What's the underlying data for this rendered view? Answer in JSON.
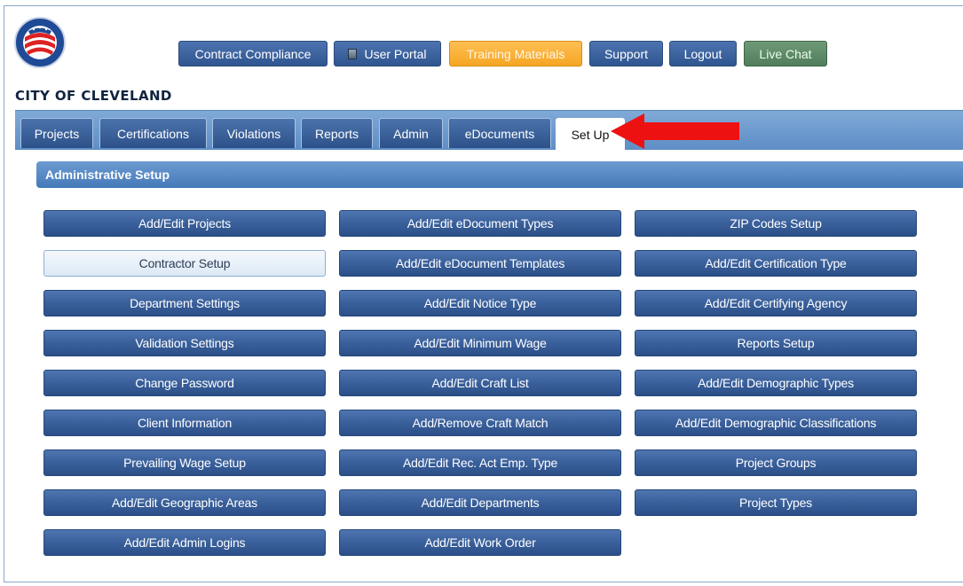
{
  "site": {
    "name": "CITY OF CLEVELAND",
    "logo_text": "CITY OF CLEVELAND OHIO"
  },
  "topnav": [
    {
      "label": "Contract Compliance"
    },
    {
      "label": "User Portal"
    },
    {
      "label": "Training Materials"
    },
    {
      "label": "Support"
    },
    {
      "label": "Logout"
    },
    {
      "label": "Live Chat"
    }
  ],
  "tabs": [
    {
      "label": "Projects"
    },
    {
      "label": "Certifications"
    },
    {
      "label": "Violations"
    },
    {
      "label": "Reports"
    },
    {
      "label": "Admin"
    },
    {
      "label": "eDocuments"
    },
    {
      "label": "Set Up",
      "active": true
    }
  ],
  "section": {
    "title": "Administrative Setup"
  },
  "columns": [
    [
      "Add/Edit Projects",
      "Contractor Setup",
      "Department Settings",
      "Validation Settings",
      "Change Password",
      "Client Information",
      "Prevailing Wage Setup",
      "Add/Edit Geographic Areas",
      "Add/Edit Admin Logins"
    ],
    [
      "Add/Edit eDocument Types",
      "Add/Edit eDocument Templates",
      "Add/Edit Notice Type",
      "Add/Edit Minimum Wage",
      "Add/Edit Craft List",
      "Add/Remove Craft Match",
      "Add/Edit Rec. Act Emp. Type",
      "Add/Edit Departments",
      "Add/Edit Work Order"
    ],
    [
      "ZIP Codes Setup",
      "Add/Edit Certification Type",
      "Add/Edit Certifying Agency",
      "Reports Setup",
      "Add/Edit Demographic Types",
      "Add/Edit Demographic Classifications",
      "Project Groups",
      "Project Types"
    ]
  ],
  "selected_button": "Contractor Setup",
  "colors": {
    "arrow": "#ee1111",
    "accent": "#3a609b",
    "training": "#f5a623",
    "chat": "#517d5c"
  }
}
